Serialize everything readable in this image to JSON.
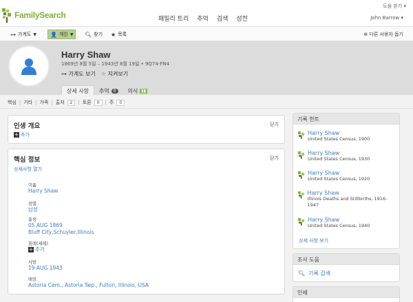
{
  "header": {
    "logo_text": "FamilySearch",
    "nav": [
      "패밀리 트리",
      "추억",
      "검색",
      "성전"
    ],
    "help": "도움 받기 ▾",
    "user": "John Barrow ▾"
  },
  "toolbar": {
    "tree_label": "가계도",
    "person_label": "개인",
    "find_label": "찾기",
    "list_label": "목록",
    "feedback_label": "다른 사용자 돕기"
  },
  "person": {
    "name": "Harry Shaw",
    "dates": "1869년 8월 5일 – 1943년 8월 19일 • 9Q74-FN4",
    "view_tree": "가계도 보기",
    "watch": "지켜보기",
    "tabs": [
      {
        "label": "상세 사항"
      },
      {
        "label": "추억",
        "count": "0"
      },
      {
        "label": "의식"
      }
    ]
  },
  "subnav": {
    "items": [
      "핵심",
      "기타",
      "가족",
      "출처",
      "토론",
      "주"
    ],
    "counts": {
      "sources": "2",
      "discussions": "0",
      "notes": "0"
    }
  },
  "summary_card": {
    "title": "인생 개요",
    "close": "닫기",
    "add": "추가"
  },
  "vitals_card": {
    "title": "핵심 정보",
    "close": "닫기",
    "show_details": "상세사항 열기",
    "fields": [
      {
        "label": "이름",
        "value": "Harry Shaw"
      },
      {
        "label": "성별",
        "value": "남성"
      },
      {
        "label": "출생",
        "value": "05 AUG 1869",
        "value2": "Bluff City,Schuyler,Illinois"
      },
      {
        "label": "침례(세례)",
        "value": "추가"
      },
      {
        "label": "사망",
        "value": "19 AUG 1943"
      },
      {
        "label": "매장",
        "value": "Astoria Cem., Astoria Twp., Fulton, Illinois, USA"
      }
    ]
  },
  "record_hints": {
    "title": "기록 힌트",
    "items": [
      {
        "name": "Harry Shaw",
        "source": "United States Census, 1900"
      },
      {
        "name": "Harry Shaw",
        "source": "United States Census, 1930"
      },
      {
        "name": "Harry Shaw",
        "source": "United States Census, 1920"
      },
      {
        "name": "Harry Shaw",
        "source": "Illinois Deaths and Stillbirths, 1916-1947"
      },
      {
        "name": "Harry Shaw",
        "source": "United States Census, 1940"
      }
    ],
    "show_details": "상세 사항 보기"
  },
  "research_help": {
    "title": "조사 도움",
    "search_records": "기록 검색"
  },
  "print_section": {
    "title": "인쇄"
  },
  "colors": {
    "brand_green": "#7fb13d",
    "link_blue": "#3b7bbf",
    "header_gray": "#dcdcdc",
    "avatar_blue": "#2f7fd8"
  }
}
